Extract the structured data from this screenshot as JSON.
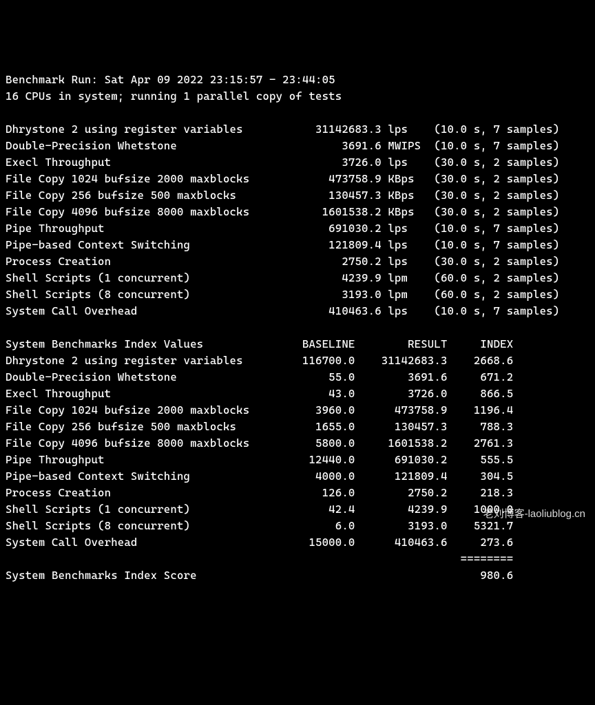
{
  "header": {
    "run_line": "Benchmark Run: Sat Apr 09 2022 23:15:57 - 23:44:05",
    "cpu_line": "16 CPUs in system; running 1 parallel copy of tests"
  },
  "tests": [
    {
      "name": "Dhrystone 2 using register variables",
      "value": "31142683.3",
      "unit": "lps",
      "time": "10.0",
      "samples": "7"
    },
    {
      "name": "Double-Precision Whetstone",
      "value": "3691.6",
      "unit": "MWIPS",
      "time": "10.0",
      "samples": "7"
    },
    {
      "name": "Execl Throughput",
      "value": "3726.0",
      "unit": "lps",
      "time": "30.0",
      "samples": "2"
    },
    {
      "name": "File Copy 1024 bufsize 2000 maxblocks",
      "value": "473758.9",
      "unit": "KBps",
      "time": "30.0",
      "samples": "2"
    },
    {
      "name": "File Copy 256 bufsize 500 maxblocks",
      "value": "130457.3",
      "unit": "KBps",
      "time": "30.0",
      "samples": "2"
    },
    {
      "name": "File Copy 4096 bufsize 8000 maxblocks",
      "value": "1601538.2",
      "unit": "KBps",
      "time": "30.0",
      "samples": "2"
    },
    {
      "name": "Pipe Throughput",
      "value": "691030.2",
      "unit": "lps",
      "time": "10.0",
      "samples": "7"
    },
    {
      "name": "Pipe-based Context Switching",
      "value": "121809.4",
      "unit": "lps",
      "time": "10.0",
      "samples": "7"
    },
    {
      "name": "Process Creation",
      "value": "2750.2",
      "unit": "lps",
      "time": "30.0",
      "samples": "2"
    },
    {
      "name": "Shell Scripts (1 concurrent)",
      "value": "4239.9",
      "unit": "lpm",
      "time": "60.0",
      "samples": "2"
    },
    {
      "name": "Shell Scripts (8 concurrent)",
      "value": "3193.0",
      "unit": "lpm",
      "time": "60.0",
      "samples": "2"
    },
    {
      "name": "System Call Overhead",
      "value": "410463.6",
      "unit": "lps",
      "time": "10.0",
      "samples": "7"
    }
  ],
  "index_header": {
    "title": "System Benchmarks Index Values",
    "baseline": "BASELINE",
    "result": "RESULT",
    "index": "INDEX"
  },
  "index_rows": [
    {
      "name": "Dhrystone 2 using register variables",
      "baseline": "116700.0",
      "result": "31142683.3",
      "index": "2668.6"
    },
    {
      "name": "Double-Precision Whetstone",
      "baseline": "55.0",
      "result": "3691.6",
      "index": "671.2"
    },
    {
      "name": "Execl Throughput",
      "baseline": "43.0",
      "result": "3726.0",
      "index": "866.5"
    },
    {
      "name": "File Copy 1024 bufsize 2000 maxblocks",
      "baseline": "3960.0",
      "result": "473758.9",
      "index": "1196.4"
    },
    {
      "name": "File Copy 256 bufsize 500 maxblocks",
      "baseline": "1655.0",
      "result": "130457.3",
      "index": "788.3"
    },
    {
      "name": "File Copy 4096 bufsize 8000 maxblocks",
      "baseline": "5800.0",
      "result": "1601538.2",
      "index": "2761.3"
    },
    {
      "name": "Pipe Throughput",
      "baseline": "12440.0",
      "result": "691030.2",
      "index": "555.5"
    },
    {
      "name": "Pipe-based Context Switching",
      "baseline": "4000.0",
      "result": "121809.4",
      "index": "304.5"
    },
    {
      "name": "Process Creation",
      "baseline": "126.0",
      "result": "2750.2",
      "index": "218.3"
    },
    {
      "name": "Shell Scripts (1 concurrent)",
      "baseline": "42.4",
      "result": "4239.9",
      "index": "1000.0"
    },
    {
      "name": "Shell Scripts (8 concurrent)",
      "baseline": "6.0",
      "result": "3193.0",
      "index": "5321.7"
    },
    {
      "name": "System Call Overhead",
      "baseline": "15000.0",
      "result": "410463.6",
      "index": "273.6"
    }
  ],
  "score_divider": "========",
  "score": {
    "label": "System Benchmarks Index Score",
    "value": "980.6"
  },
  "watermark": "老刘博客-laoliublog.cn"
}
